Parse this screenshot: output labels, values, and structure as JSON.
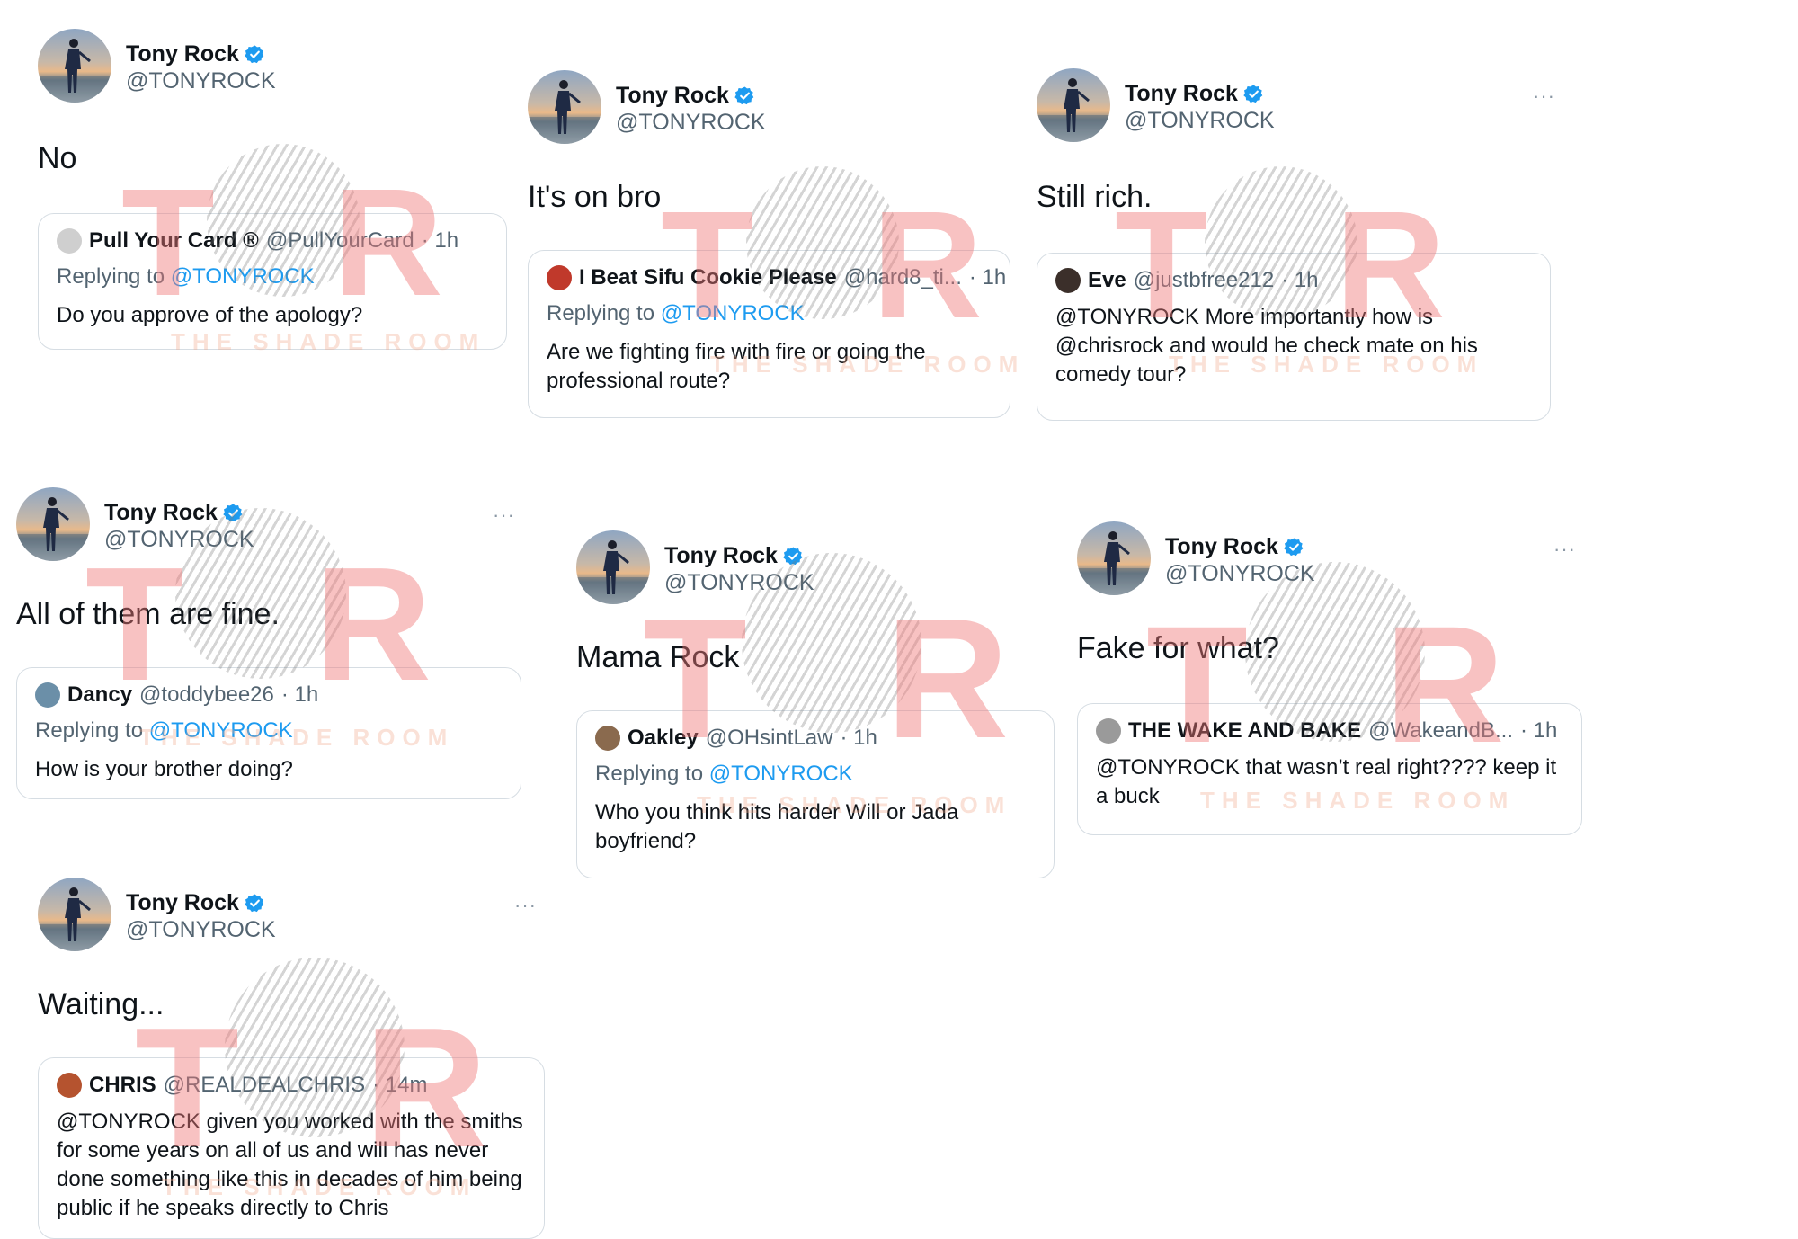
{
  "colors": {
    "link": "#1d9bf0",
    "verified": "#1d9bf0",
    "muted": "#536471",
    "watermark": "#f07878"
  },
  "watermark": {
    "left": "T",
    "right": "R",
    "brand": "THE SHADE ROOM"
  },
  "tweets": [
    {
      "author": "Tony Rock",
      "handle": "@TONYROCK",
      "text": "No",
      "more": "",
      "quote": {
        "name": "Pull Your Card ®",
        "handle": "@PullYourCard",
        "time": "· 1h",
        "replying": "Replying to",
        "mention": "@TONYROCK",
        "body": "Do you approve of the apology?"
      }
    },
    {
      "author": "Tony Rock",
      "handle": "@TONYROCK",
      "text": "It's on bro",
      "more": "",
      "quote": {
        "name": "I Beat Sifu Cookie Please",
        "handle": "@hard8_ti...",
        "time": "· 1h",
        "replying": "Replying to",
        "mention": "@TONYROCK",
        "body": "Are we fighting fire with fire or going the professional route?"
      }
    },
    {
      "author": "Tony Rock",
      "handle": "@TONYROCK",
      "text": "Still rich.",
      "more": "···",
      "quote": {
        "name": "Eve",
        "handle": "@justbfree212",
        "time": "· 1h",
        "replying": "",
        "mention": "",
        "body": "@TONYROCK More importantly how is @chrisrock and would he check mate on his comedy tour?"
      }
    },
    {
      "author": "Tony Rock",
      "handle": "@TONYROCK",
      "text": "All of them are fine.",
      "more": "···",
      "quote": {
        "name": "Dancy",
        "handle": "@toddybee26",
        "time": "· 1h",
        "replying": "Replying to",
        "mention": "@TONYROCK",
        "body": "How is your brother doing?"
      }
    },
    {
      "author": "Tony Rock",
      "handle": "@TONYROCK",
      "text": "Mama Rock",
      "more": "",
      "quote": {
        "name": "Oakley",
        "handle": "@OHsintLaw",
        "time": "· 1h",
        "replying": "Replying to",
        "mention": "@TONYROCK",
        "body": "Who you think hits harder Will or Jada boyfriend?"
      }
    },
    {
      "author": "Tony Rock",
      "handle": "@TONYROCK",
      "text": "Fake for what?",
      "more": "···",
      "quote": {
        "name": "THE WAKE AND BAKE",
        "handle": "@WakeandB...",
        "time": "· 1h",
        "replying": "",
        "mention": "",
        "body": "@TONYROCK that wasn’t real right???? keep it a buck"
      }
    },
    {
      "author": "Tony Rock",
      "handle": "@TONYROCK",
      "text": "Waiting...",
      "more": "···",
      "quote": {
        "name": "CHRIS",
        "handle": "@REALDEALCHRIS",
        "time": "· 14m",
        "replying": "",
        "mention": "",
        "body": "@TONYROCK given you worked with the smiths for some years on all of us and will has never done something like this in decades of him being public if he speaks directly to Chris"
      }
    }
  ]
}
